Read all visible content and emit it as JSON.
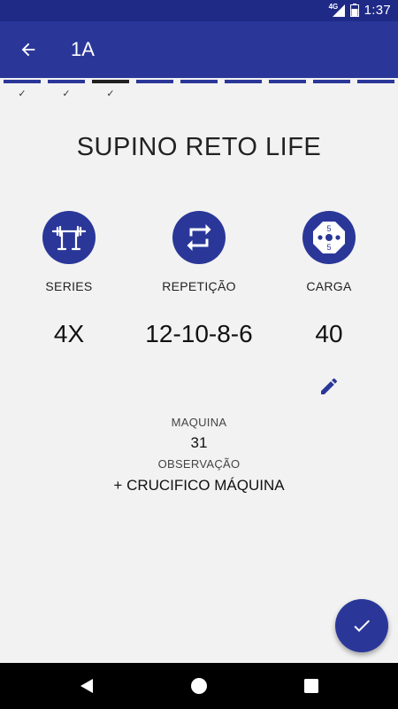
{
  "status_bar": {
    "time": "1:37",
    "network": "4G"
  },
  "app_bar": {
    "title": "1A",
    "back_icon": "arrow-left-icon"
  },
  "steps": {
    "checkmark": "✓",
    "items": [
      {
        "state": "done"
      },
      {
        "state": "done"
      },
      {
        "state": "current"
      },
      {
        "state": "pending"
      },
      {
        "state": "pending"
      },
      {
        "state": "pending"
      },
      {
        "state": "pending"
      },
      {
        "state": "pending"
      },
      {
        "state": "pending"
      }
    ]
  },
  "exercise": {
    "name": "SUPINO RETO LIFE",
    "series": {
      "label": "SERIES",
      "value": "4X",
      "icon": "barbell-rack-icon"
    },
    "repetition": {
      "label": "REPETIÇÃO",
      "value": "12-10-8-6",
      "icon": "repeat-icon"
    },
    "load": {
      "label": "CARGA",
      "value": "40",
      "icon": "weight-plate-icon",
      "plate_number": "5"
    },
    "machine_label": "MAQUINA",
    "machine_value": "31",
    "observation_label": "OBSERVAÇÃO",
    "observation_value": "+ CRUCIFICO MÁQUINA"
  },
  "actions": {
    "edit_icon": "pencil-icon",
    "confirm_icon": "check-icon"
  },
  "colors": {
    "primary": "#2a3799",
    "status_bar": "#1f2a87",
    "background": "#f2f2f2"
  }
}
